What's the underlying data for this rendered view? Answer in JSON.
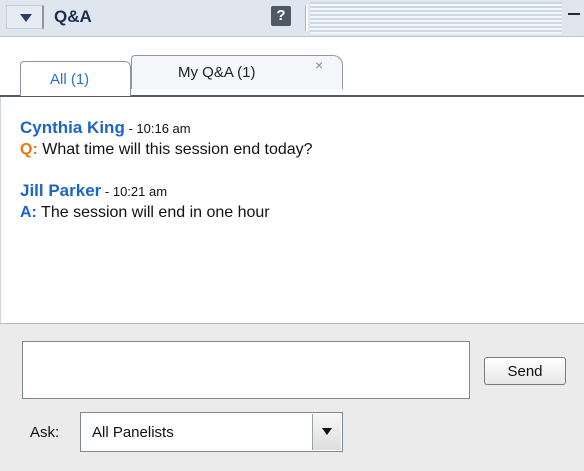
{
  "panel": {
    "title": "Q&A",
    "help_label": "?"
  },
  "tabs": [
    {
      "label": "All (1)",
      "active": true
    },
    {
      "label": "My Q&A (1)",
      "close": "×"
    }
  ],
  "messages": [
    {
      "name": "Cynthia King",
      "sep": " - ",
      "time": "10:16 am",
      "tag": "Q:",
      "text": "What time will this session end today?"
    },
    {
      "name": "Jill Parker",
      "sep": " - ",
      "time": "10:21 am",
      "tag": "A:",
      "text": "The session will end in one hour"
    }
  ],
  "input": {
    "question_value": "",
    "send_label": "Send"
  },
  "ask": {
    "label": "Ask:",
    "selected": "All Panelists"
  },
  "colors": {
    "accent": "#1d64c7",
    "question": "#e37a16"
  },
  "icons": {
    "collapse": "triangle-down-icon",
    "help": "help-icon",
    "minimize": "minimize-icon",
    "dropdown": "chevron-down-icon"
  }
}
